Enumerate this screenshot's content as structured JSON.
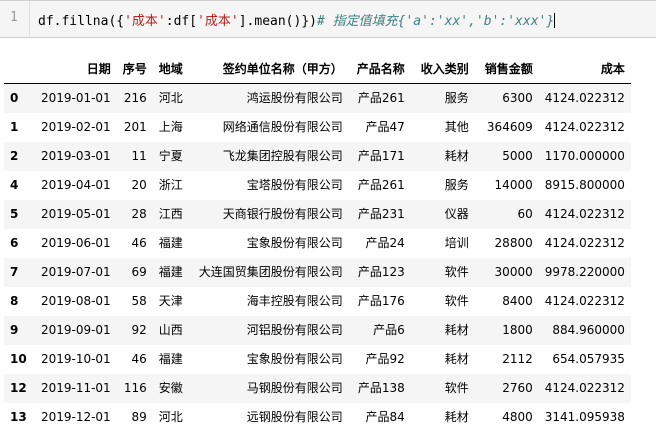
{
  "code": {
    "line_number": "1",
    "parts": [
      {
        "text": "df.fillna({",
        "cls": ""
      },
      {
        "text": "'成本'",
        "cls": "tok-str"
      },
      {
        "text": ":df[",
        "cls": ""
      },
      {
        "text": "'成本'",
        "cls": "tok-str"
      },
      {
        "text": "].mean()})",
        "cls": ""
      },
      {
        "text": "# 指定值填充{'a':'xx','b':'xxx'}",
        "cls": "tok-cm"
      }
    ]
  },
  "table": {
    "columns": [
      "",
      "日期",
      "序号",
      "地域",
      "签约单位名称（甲方）",
      "产品名称",
      "收入类别",
      "销售金额",
      "成本"
    ],
    "rows": [
      {
        "idx": "0",
        "date": "2019-01-01",
        "seq": "216",
        "region": "河北",
        "company": "鸿运股份有限公司",
        "product": "产品261",
        "type": "服务",
        "sales": "6300",
        "cost": "4124.022312"
      },
      {
        "idx": "1",
        "date": "2019-02-01",
        "seq": "201",
        "region": "上海",
        "company": "网络通信股份有限公司",
        "product": "产品47",
        "type": "其他",
        "sales": "364609",
        "cost": "4124.022312"
      },
      {
        "idx": "2",
        "date": "2019-03-01",
        "seq": "11",
        "region": "宁夏",
        "company": "飞龙集团控股有限公司",
        "product": "产品171",
        "type": "耗材",
        "sales": "5000",
        "cost": "1170.000000"
      },
      {
        "idx": "4",
        "date": "2019-04-01",
        "seq": "20",
        "region": "浙江",
        "company": "宝塔股份有限公司",
        "product": "产品261",
        "type": "服务",
        "sales": "14000",
        "cost": "8915.800000"
      },
      {
        "idx": "5",
        "date": "2019-05-01",
        "seq": "28",
        "region": "江西",
        "company": "天商银行股份有限公司",
        "product": "产品231",
        "type": "仪器",
        "sales": "60",
        "cost": "4124.022312"
      },
      {
        "idx": "6",
        "date": "2019-06-01",
        "seq": "46",
        "region": "福建",
        "company": "宝象股份有限公司",
        "product": "产品24",
        "type": "培训",
        "sales": "28800",
        "cost": "4124.022312"
      },
      {
        "idx": "7",
        "date": "2019-07-01",
        "seq": "69",
        "region": "福建",
        "company": "大连国贸集团股份有限公司",
        "product": "产品123",
        "type": "软件",
        "sales": "30000",
        "cost": "9978.220000"
      },
      {
        "idx": "8",
        "date": "2019-08-01",
        "seq": "58",
        "region": "天津",
        "company": "海丰控股有限公司",
        "product": "产品176",
        "type": "软件",
        "sales": "8400",
        "cost": "4124.022312"
      },
      {
        "idx": "9",
        "date": "2019-09-01",
        "seq": "92",
        "region": "山西",
        "company": "河铝股份有限公司",
        "product": "产品6",
        "type": "耗材",
        "sales": "1800",
        "cost": "884.960000"
      },
      {
        "idx": "10",
        "date": "2019-10-01",
        "seq": "46",
        "region": "福建",
        "company": "宝象股份有限公司",
        "product": "产品92",
        "type": "耗材",
        "sales": "2112",
        "cost": "654.057935"
      },
      {
        "idx": "12",
        "date": "2019-11-01",
        "seq": "116",
        "region": "安徽",
        "company": "马钢股份有限公司",
        "product": "产品138",
        "type": "软件",
        "sales": "2760",
        "cost": "4124.022312"
      },
      {
        "idx": "13",
        "date": "2019-12-01",
        "seq": "89",
        "region": "河北",
        "company": "远钢股份有限公司",
        "product": "产品84",
        "type": "耗材",
        "sales": "4800",
        "cost": "3141.095938"
      }
    ]
  }
}
